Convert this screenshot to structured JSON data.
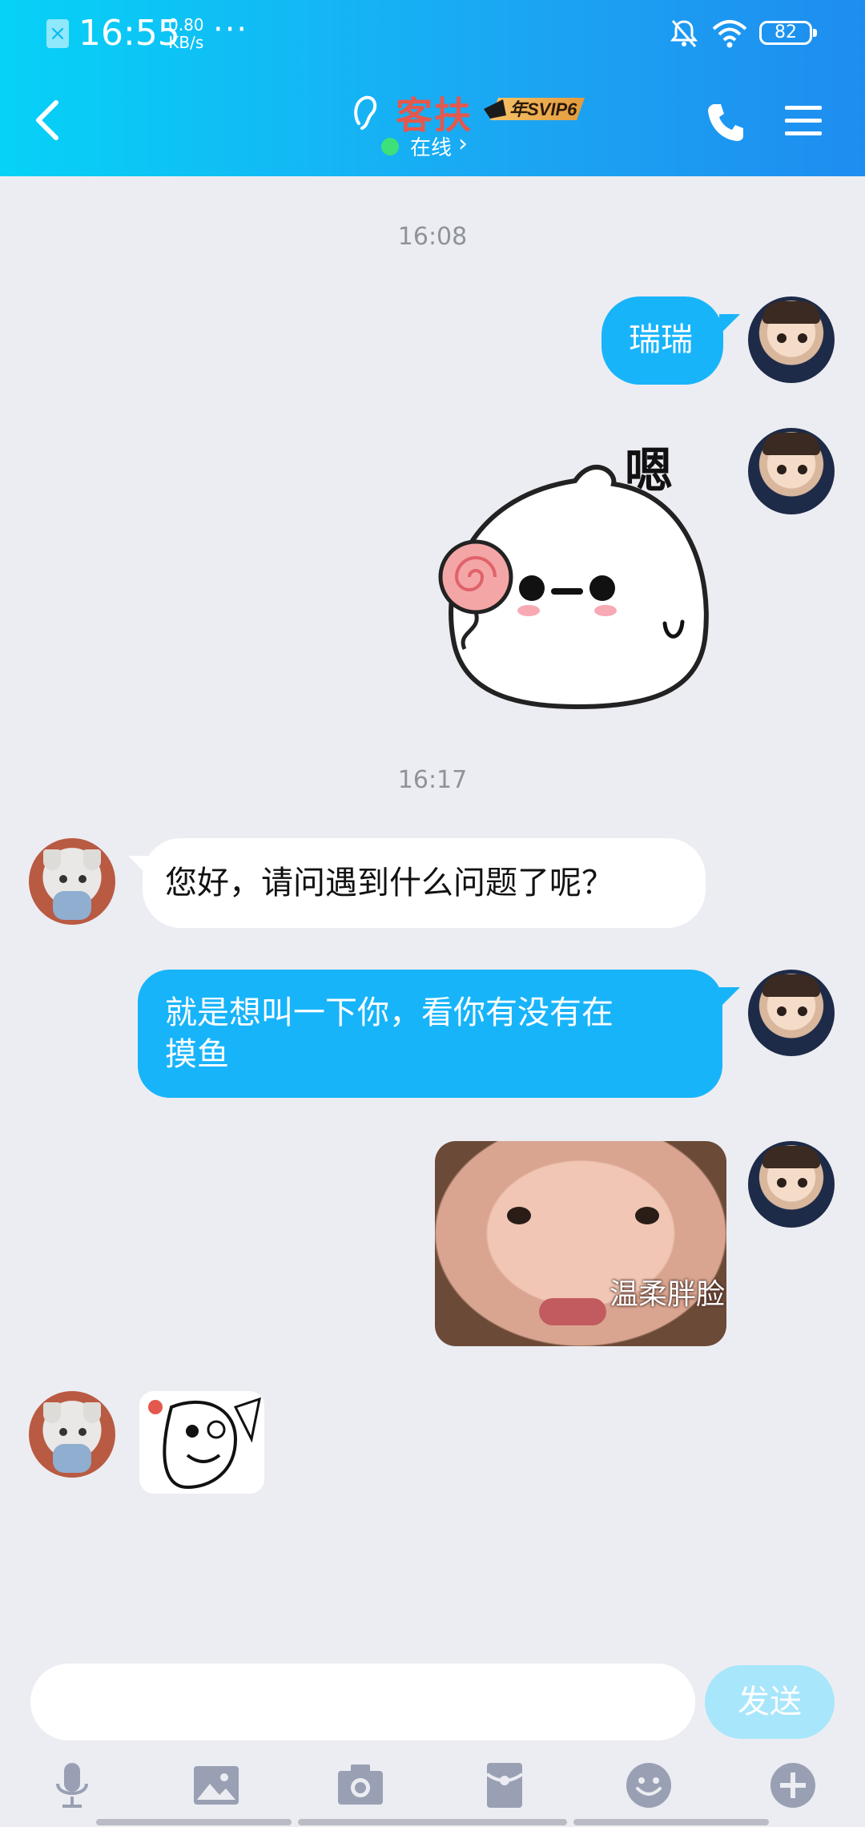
{
  "status_bar": {
    "time": "16:55",
    "speed_value": "0.80",
    "speed_unit": "KB/s",
    "more": "···",
    "battery": "82",
    "sim_icon": "sim-missing-icon",
    "bell_icon": "bell-muted-icon",
    "wifi_icon": "wifi-icon"
  },
  "header": {
    "title": "客扶",
    "vip_badge": "年SVIP6",
    "status": "在线",
    "status_chevron": "›",
    "colors": {
      "gradient_start": "#06d2f7",
      "gradient_end": "#1e8df0",
      "title": "#e4584d",
      "online": "#3ee07a"
    }
  },
  "messages": [
    {
      "type": "timestamp",
      "text": "16:08"
    },
    {
      "type": "text",
      "sender": "me",
      "text": "瑞瑞"
    },
    {
      "type": "sticker",
      "sender": "me",
      "sticker_text": "嗯"
    },
    {
      "type": "timestamp",
      "text": "16:17"
    },
    {
      "type": "text",
      "sender": "other",
      "text": "您好，请问遇到什么问题了呢？"
    },
    {
      "type": "text",
      "sender": "me",
      "text_line1": "就是想叫一下你，看你有没有在",
      "text_line2": "摸鱼"
    },
    {
      "type": "image",
      "sender": "me",
      "caption": "温柔胖脸"
    },
    {
      "type": "image",
      "sender": "other",
      "caption": ""
    }
  ],
  "input": {
    "placeholder": "",
    "send_label": "发送"
  },
  "toolbar": [
    {
      "icon": "microphone-icon"
    },
    {
      "icon": "image-icon"
    },
    {
      "icon": "camera-icon"
    },
    {
      "icon": "red-packet-icon"
    },
    {
      "icon": "emoji-icon"
    },
    {
      "icon": "plus-icon"
    }
  ],
  "colors": {
    "bubble_me": "#18b4fa",
    "bubble_other": "#ffffff",
    "background": "#ecedf2",
    "send_button": "#a8e6fb"
  }
}
